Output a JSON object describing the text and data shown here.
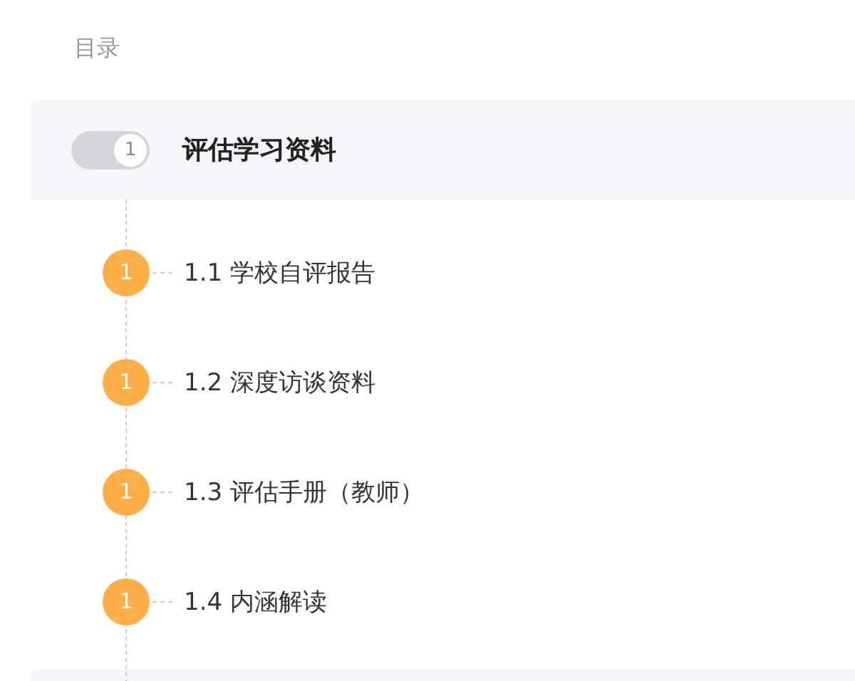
{
  "heading": "目录",
  "sections": [
    {
      "title": "评估学习资料",
      "count": "1",
      "children": [
        {
          "label": "1.1 学校自评报告",
          "count": "1"
        },
        {
          "label": "1.2 深度访谈资料",
          "count": "1"
        },
        {
          "label": "1.3 评估手册（教师）",
          "count": "1"
        },
        {
          "label": "1.4 内涵解读",
          "count": "1"
        }
      ]
    }
  ]
}
